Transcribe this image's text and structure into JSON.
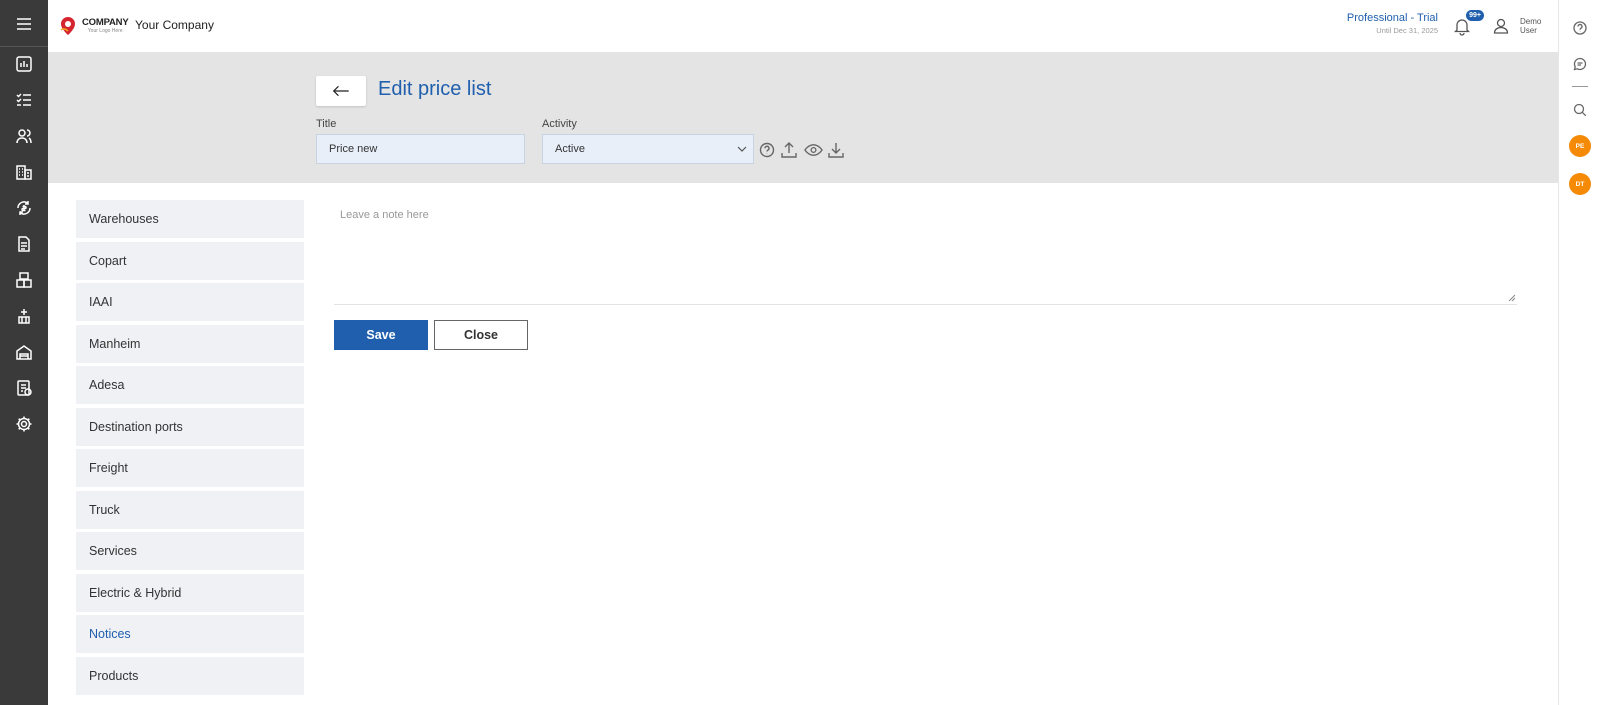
{
  "sidebar": {
    "items": [
      {
        "icon": "menu-icon"
      },
      {
        "icon": "dashboard-chart-icon"
      },
      {
        "icon": "checklist-icon"
      },
      {
        "icon": "contacts-icon"
      },
      {
        "icon": "building-icon"
      },
      {
        "icon": "exchange-icon"
      },
      {
        "icon": "document-icon"
      },
      {
        "icon": "boxes-icon"
      },
      {
        "icon": "crane-icon"
      },
      {
        "icon": "warehouse-icon"
      },
      {
        "icon": "invoice-icon"
      },
      {
        "icon": "gear-icon"
      }
    ]
  },
  "header": {
    "logo_text": "COMPANY",
    "logo_subtext": "Your Logo Here",
    "company_name": "Your Company",
    "plan_name": "Professional - Trial",
    "plan_until": "Until Dec 31, 2025",
    "notification_badge": "99+",
    "user_name": "Demo User"
  },
  "rail": {
    "avatars": [
      "PE",
      "DT"
    ]
  },
  "page": {
    "title": "Edit price list",
    "title_label": "Title",
    "title_value": "Price new",
    "activity_label": "Activity",
    "activity_value": "Active"
  },
  "tabs": [
    "Warehouses",
    "Copart",
    "IAAI",
    "Manheim",
    "Adesa",
    "Destination ports",
    "Freight",
    "Truck",
    "Services",
    "Electric & Hybrid",
    "Notices",
    "Products"
  ],
  "active_tab": "Notices",
  "note": {
    "placeholder": "Leave a note here"
  },
  "actions": {
    "save_label": "Save",
    "close_label": "Close"
  },
  "colors": {
    "accent": "#1f5fae",
    "sidebar": "#3a3a3a",
    "avatar": "#f58a07"
  }
}
